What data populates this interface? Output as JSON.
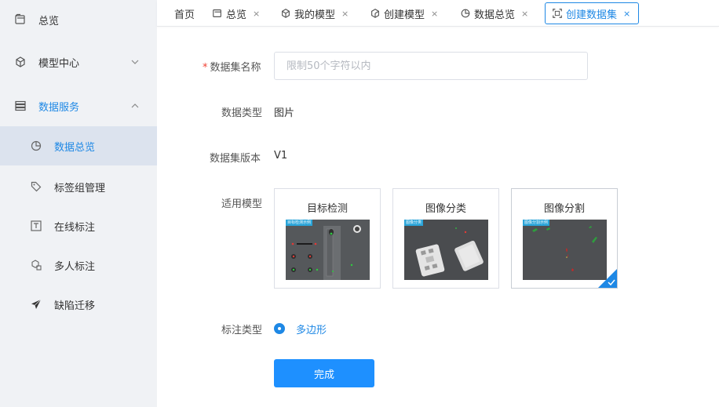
{
  "sidebar": {
    "items": [
      {
        "label": "总览",
        "icon": "overview-icon"
      },
      {
        "label": "模型中心",
        "icon": "cube-icon"
      },
      {
        "label": "数据服务",
        "icon": "database-icon"
      },
      {
        "label": "数据总览",
        "icon": "pie-chart-icon"
      },
      {
        "label": "标签组管理",
        "icon": "tag-icon"
      },
      {
        "label": "在线标注",
        "icon": "text-box-icon"
      },
      {
        "label": "多人标注",
        "icon": "multi-box-icon"
      },
      {
        "label": "缺陷迁移",
        "icon": "paper-plane-icon"
      }
    ]
  },
  "tabs": [
    {
      "label": "首页"
    },
    {
      "label": "总览"
    },
    {
      "label": "我的模型"
    },
    {
      "label": "创建模型"
    },
    {
      "label": "数据总览"
    },
    {
      "label": "创建数据集"
    }
  ],
  "tab_close": "×",
  "form": {
    "name_label": "数据集名称",
    "required_mark": "*",
    "name_placeholder": "限制50个字符以内",
    "name_value": "",
    "type_label": "数据类型",
    "type_value": "图片",
    "version_label": "数据集版本",
    "version_value": "V1",
    "model_label": "适用模型",
    "models": [
      {
        "title": "目标检测",
        "tag": "目标检测示例"
      },
      {
        "title": "图像分类",
        "tag": "图像分类"
      },
      {
        "title": "图像分割",
        "tag": "图像分割示例"
      }
    ],
    "selected_model": "图像分割",
    "annotation_label": "标注类型",
    "annotation_value": "多边形",
    "submit_label": "完成"
  },
  "colors": {
    "accent": "#1e88e5",
    "button": "#1e90ff",
    "sidebar_bg": "#f0f2f5",
    "required": "#f04134"
  }
}
